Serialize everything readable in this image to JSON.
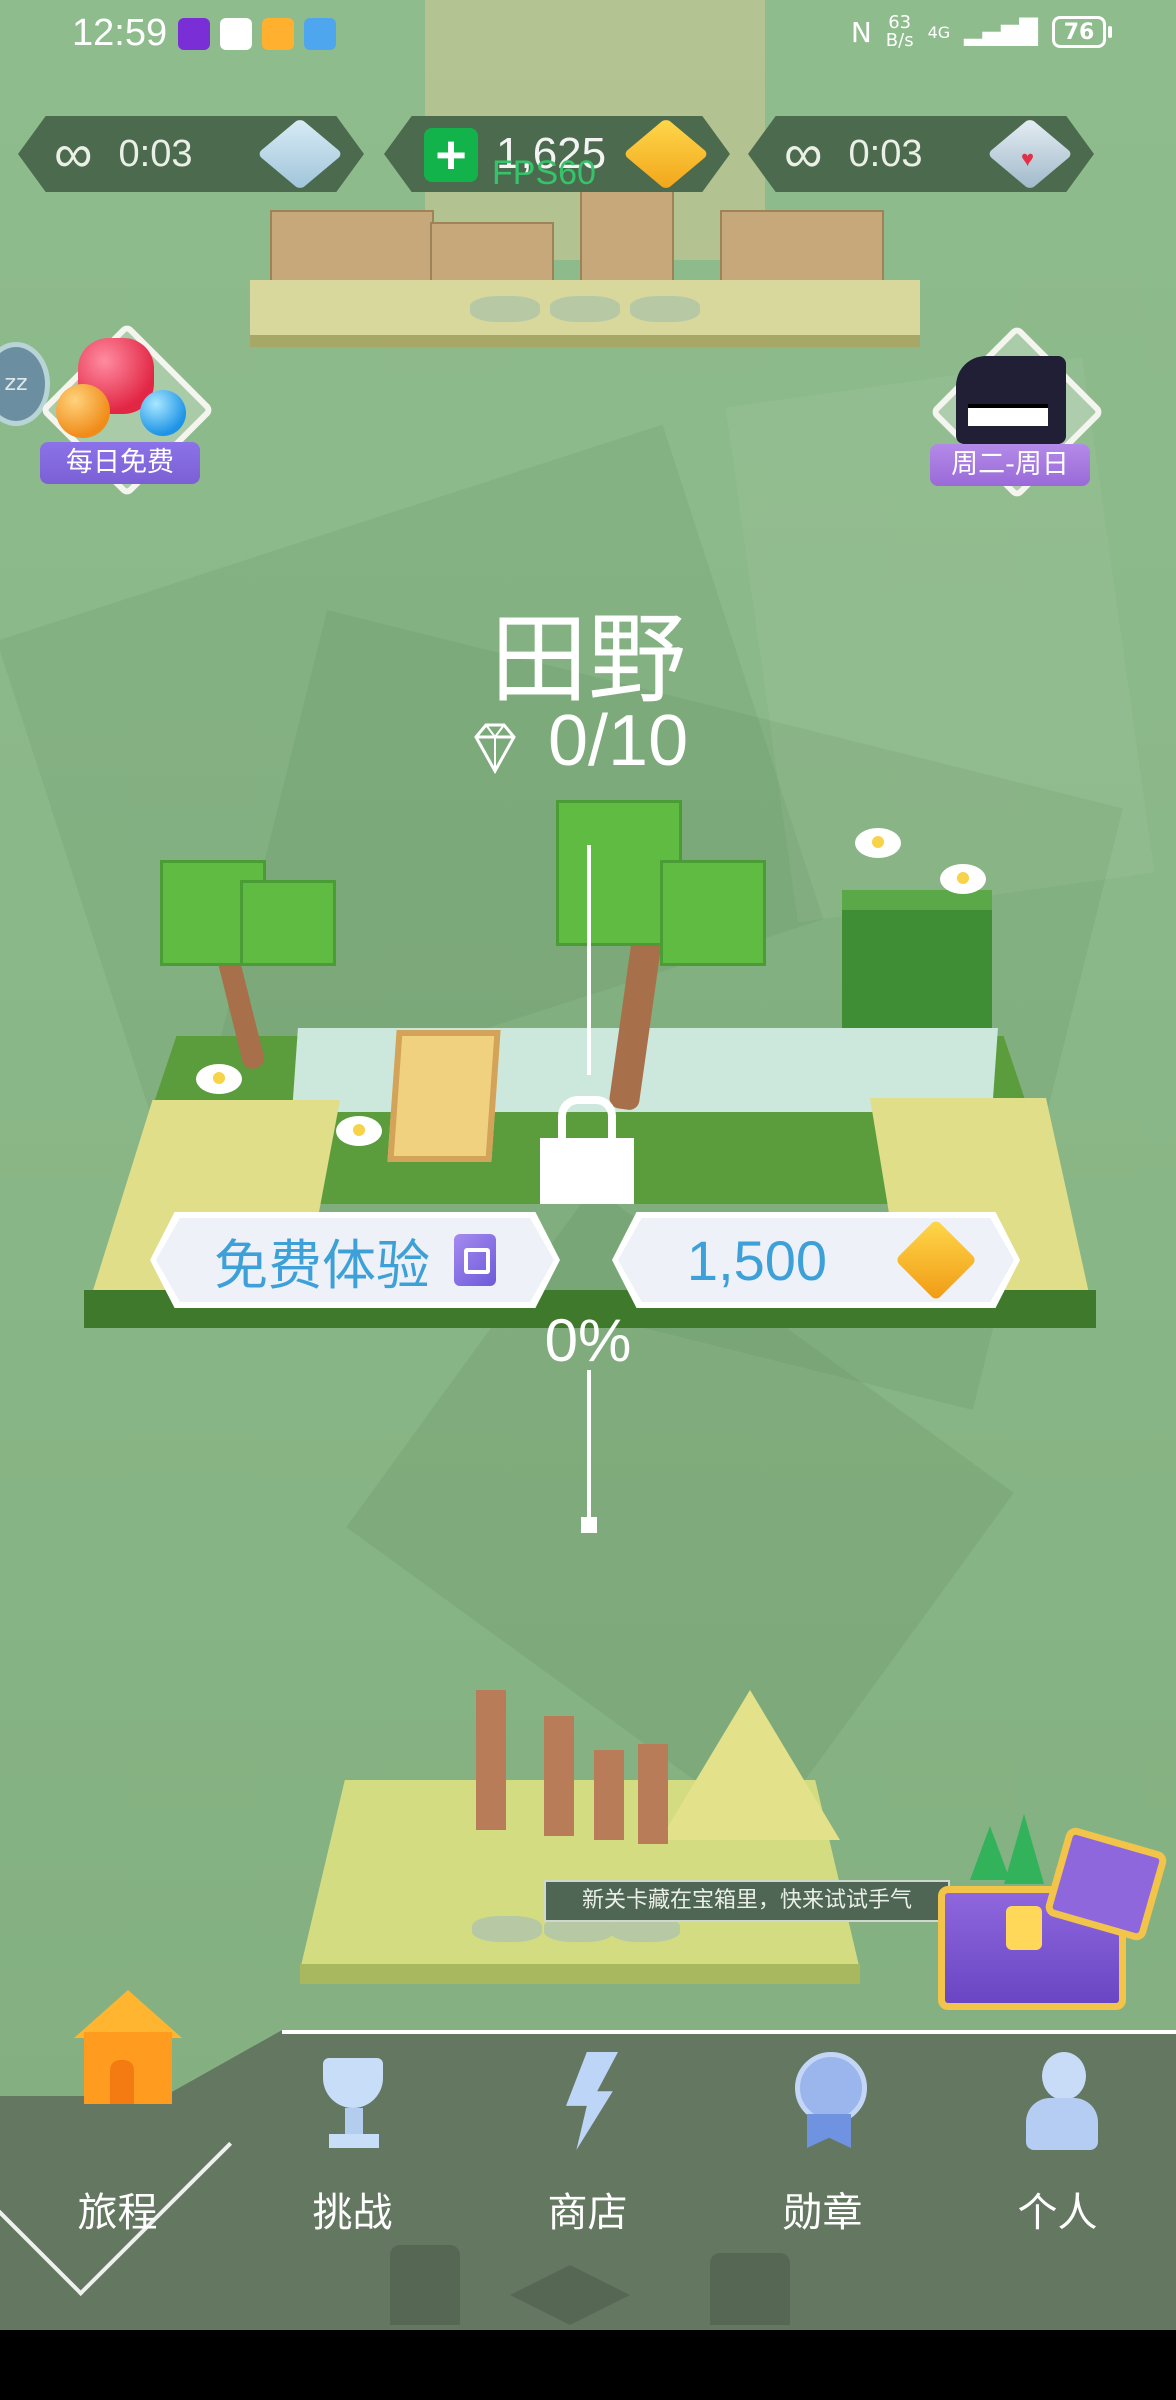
{
  "status_bar": {
    "time": "12:59",
    "net_speed_value": "63",
    "net_speed_unit": "B/s",
    "network": "4G",
    "battery": "76"
  },
  "stats": {
    "revive_time_left": "0:03",
    "coins": "1,625",
    "fps": "FPS60",
    "heart_time_left": "0:03",
    "infinity_symbol": "∞"
  },
  "badges": {
    "daily_free": "每日免费",
    "schedule": "周二-周日",
    "sleep": "zz"
  },
  "level": {
    "name": "田野",
    "gems": "0/10",
    "progress": "0%"
  },
  "actions": {
    "free_trial": "免费体验",
    "price": "1,500"
  },
  "hint": "新关卡藏在宝箱里，快来试试手气",
  "nav": {
    "items": [
      {
        "label": "旅程",
        "icon": "home-icon",
        "active": true
      },
      {
        "label": "挑战",
        "icon": "trophy-icon",
        "active": false
      },
      {
        "label": "商店",
        "icon": "store-bolt-icon",
        "active": false
      },
      {
        "label": "勋章",
        "icon": "medal-icon",
        "active": false
      },
      {
        "label": "个人",
        "icon": "person-icon",
        "active": false
      }
    ]
  },
  "colors": {
    "background": "#8fbc8d",
    "accent_blue": "#3ea0d8",
    "nav_bg": "#647760",
    "daily_label": "#7b60d5",
    "schedule_label": "#9a6ad8"
  }
}
